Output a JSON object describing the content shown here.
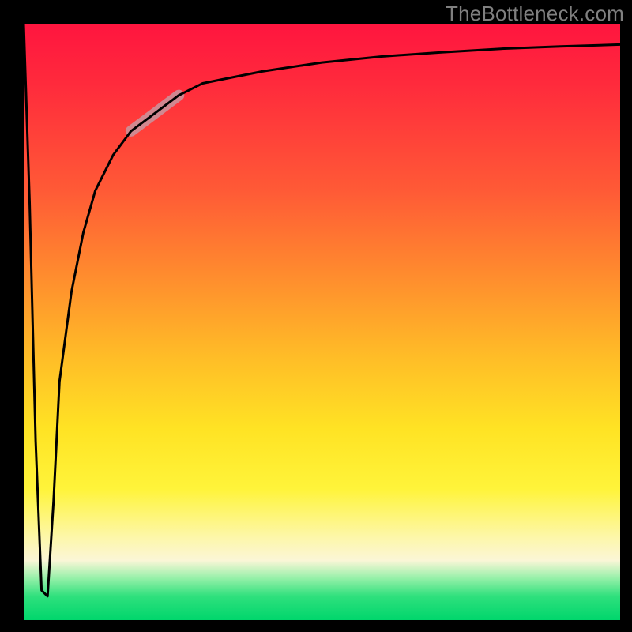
{
  "watermark": "TheBottleneck.com",
  "chart_data": {
    "type": "line",
    "title": "",
    "xlabel": "",
    "ylabel": "",
    "xlim": [
      0,
      100
    ],
    "ylim": [
      0,
      100
    ],
    "grid": false,
    "legend": false,
    "background_gradient": {
      "direction": "vertical",
      "stops": [
        {
          "pos": 0,
          "color": "#ff153f"
        },
        {
          "pos": 50,
          "color": "#ffbd27"
        },
        {
          "pos": 80,
          "color": "#fff43a"
        },
        {
          "pos": 92,
          "color": "#fbf6d7"
        },
        {
          "pos": 100,
          "color": "#00d66c"
        }
      ]
    },
    "series": [
      {
        "name": "bottleneck-curve",
        "x": [
          0,
          1,
          2,
          3,
          4,
          5,
          6,
          8,
          10,
          12,
          15,
          18,
          22,
          26,
          30,
          35,
          40,
          50,
          60,
          70,
          80,
          90,
          100
        ],
        "y": [
          100,
          70,
          30,
          5,
          4,
          20,
          40,
          55,
          65,
          72,
          78,
          82,
          85,
          88,
          90,
          91,
          92,
          93.5,
          94.5,
          95.2,
          95.8,
          96.2,
          96.5
        ]
      }
    ],
    "highlight_segment": {
      "series": "bottleneck-curve",
      "x_start": 18,
      "x_end": 26
    }
  }
}
